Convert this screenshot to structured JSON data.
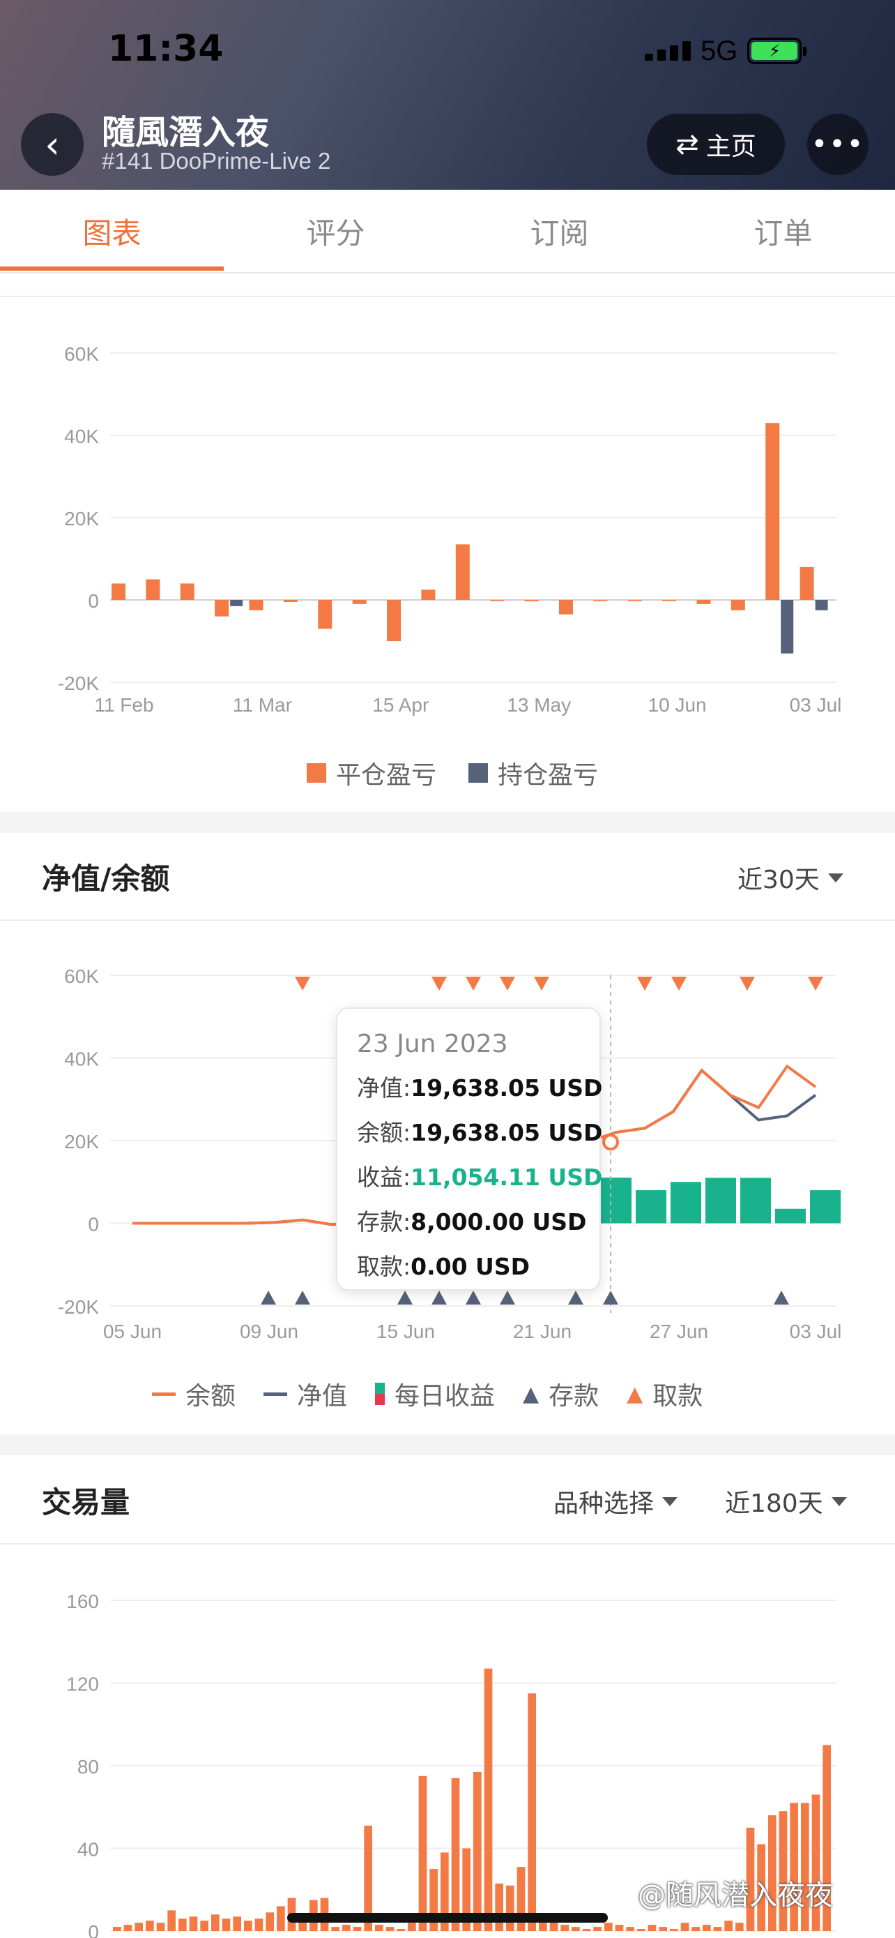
{
  "status_bar": {
    "time": "11:34",
    "network": "5G"
  },
  "header": {
    "title": "隨風潛入夜",
    "subtitle": "#141 DooPrime-Live 2",
    "home_label": "主页"
  },
  "tabs": [
    {
      "label": "图表",
      "active": true
    },
    {
      "label": "评分",
      "active": false
    },
    {
      "label": "订阅",
      "active": false
    },
    {
      "label": "订单",
      "active": false
    }
  ],
  "colors": {
    "accent": "#f0703c",
    "closed_pnl": "#f47a45",
    "open_pnl": "#55627a",
    "daily_gain": "#18b38d",
    "deposit": "#55627a",
    "withdraw": "#f47a45"
  },
  "equity_section": {
    "title": "净值/余额",
    "range": "近30天"
  },
  "volume_section": {
    "title": "交易量",
    "filter": "品种选择",
    "range": "近180天"
  },
  "tooltip": {
    "date": "23 Jun 2023",
    "equity_label": "净值:",
    "equity_value": "19,638.05 USD",
    "balance_label": "余额:",
    "balance_value": "19,638.05 USD",
    "gain_label": "收益:",
    "gain_value": "11,054.11 USD",
    "deposit_label": "存款:",
    "deposit_value": "8,000.00 USD",
    "withdraw_label": "取款:",
    "withdraw_value": "0.00 USD"
  },
  "watermark": "@随风潜入夜夜",
  "chart_data": [
    {
      "type": "bar",
      "y_ticks": [
        "60K",
        "40K",
        "20K",
        "0",
        "-20K"
      ],
      "x_ticks": [
        "11 Feb",
        "11 Mar",
        "15 Apr",
        "13 May",
        "10 Jun",
        "03 Jul"
      ],
      "ylim": [
        -20000,
        60000
      ],
      "series": [
        {
          "name": "平仓盈亏",
          "values": [
            4000,
            5000,
            4000,
            -4000,
            -2500,
            -500,
            -7000,
            -1000,
            -10000,
            2500,
            13500,
            0,
            -300,
            -3500,
            0,
            -200,
            -200,
            -1000,
            -2500,
            43000,
            8000
          ]
        },
        {
          "name": "持仓盈亏",
          "values": [
            -1500,
            -13000,
            -2500
          ]
        }
      ],
      "legend": [
        "平仓盈亏",
        "持仓盈亏"
      ]
    },
    {
      "type": "line",
      "y_ticks": [
        "60K",
        "40K",
        "20K",
        "0",
        "-20K"
      ],
      "x_ticks": [
        "05 Jun",
        "09 Jun",
        "15 Jun",
        "21 Jun",
        "27 Jun",
        "03 Jul"
      ],
      "ylim": [
        -20000,
        60000
      ],
      "balance": [
        0,
        0,
        0,
        0,
        0,
        200,
        800,
        -300,
        0,
        5000,
        9000,
        12000,
        14000,
        16000,
        18000,
        20000,
        19638,
        22000,
        23000,
        27000,
        37000,
        31000,
        28000,
        38000,
        33000
      ],
      "equity": [
        0,
        0,
        0,
        0,
        0,
        200,
        800,
        -300,
        0,
        5000,
        9000,
        12000,
        14000,
        16000,
        18000,
        20000,
        19638,
        22000,
        23000,
        27000,
        37000,
        31000,
        25000,
        26000,
        31000
      ],
      "daily_gain": [
        11054,
        8000,
        10000,
        11000,
        11000,
        3500,
        8000
      ],
      "legend": [
        "余额",
        "净值",
        "每日收益",
        "存款",
        "取款"
      ]
    },
    {
      "type": "bar",
      "y_ticks": [
        "160",
        "120",
        "80",
        "40",
        "0"
      ],
      "ylim": [
        0,
        160
      ],
      "series": [
        {
          "name": "交易量",
          "values": [
            2,
            3,
            4,
            5,
            4,
            10,
            6,
            7,
            5,
            8,
            6,
            7,
            5,
            6,
            9,
            12,
            16,
            5,
            15,
            16,
            2,
            3,
            2,
            51,
            3,
            2,
            1,
            4,
            75,
            30,
            38,
            74,
            40,
            77,
            127,
            23,
            22,
            31,
            115,
            4,
            6,
            3,
            2,
            1,
            2,
            4,
            3,
            2,
            1,
            3,
            2,
            1,
            4,
            2,
            3,
            2,
            5,
            4,
            50,
            42,
            56,
            58,
            62,
            62,
            66,
            90
          ]
        }
      ]
    }
  ]
}
